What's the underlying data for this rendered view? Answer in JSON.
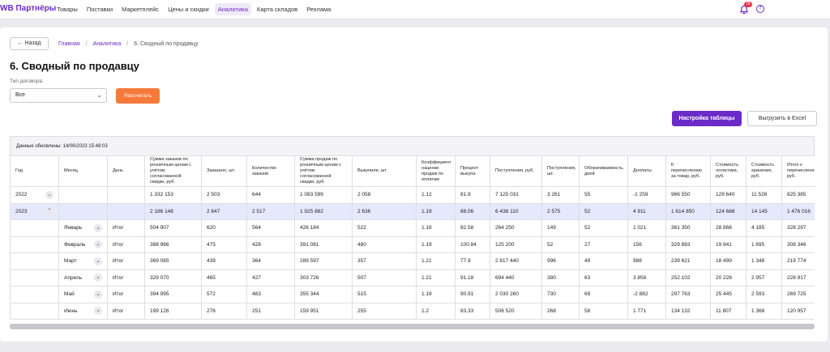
{
  "brand": "WB Партнёры",
  "nav": [
    "Товары",
    "Поставки",
    "Маркетплейс",
    "Цены и скидки",
    "Аналитика",
    "Карта складов",
    "Реклама"
  ],
  "nav_active_index": 4,
  "notification_count": "76",
  "breadcrumb": {
    "back": "← Назад",
    "items": [
      "Главная",
      "Аналитика",
      "6. Сводный по продавцу"
    ]
  },
  "title": "6. Сводный по продавцу",
  "contract_label": "Тип договора",
  "contract_value": "Все",
  "recalc_label": "Рассчитать",
  "settings_label": "Настройка таблицы",
  "export_label": "Выгрузить в Excel",
  "updated": "Данные обновлены: 14/06/2023 15:48:03",
  "columns": [
    "Год",
    "Месяц",
    "День",
    "Сумма заказов по розничным ценам с учётом согласованной скидки, руб.",
    "Заказано, шт.",
    "Количество заказов",
    "Сумма продаж по розничным ценам с учётом согласованной скидки, руб.",
    "Выкупили, шт.",
    "Коэффициент наценки продаж по оплатам",
    "Процент выкупа",
    "Поступления, руб.",
    "Поступления, шт.",
    "Оборачиваемость, дней",
    "Доплаты",
    "К перечислению за товар, руб.",
    "Стоимость логистики, руб.",
    "Стоимость хранения, руб.",
    "Итого к перечислению, руб."
  ],
  "rows": [
    {
      "year": "2022",
      "month": "",
      "day": "",
      "expanded": false,
      "values": [
        "1 332 153",
        "2 503",
        "644",
        "1 083 599",
        "2 058",
        "1.12",
        "81.9",
        "7 125 031",
        "3 261",
        "55",
        "-1 259",
        "966 550",
        "129 640",
        "11 526",
        "825 385"
      ]
    },
    {
      "year": "2023",
      "month": "",
      "day": "",
      "expanded": true,
      "values": [
        "2 186 148",
        "2 847",
        "2 517",
        "1 925 882",
        "2 636",
        "1.19",
        "88.06",
        "6 438 110",
        "2 575",
        "52",
        "4 911",
        "1 614 850",
        "124 688",
        "14 145",
        "1 476 016"
      ]
    },
    {
      "year": "",
      "month": "Январь",
      "day": "Итог",
      "values": [
        "504 907",
        "620",
        "564",
        "426 184",
        "522",
        "1.18",
        "82.58",
        "264 250",
        "149",
        "52",
        "1 021",
        "361 350",
        "28 868",
        "4 185",
        "328 297"
      ]
    },
    {
      "year": "",
      "month": "Февраль",
      "day": "Итог",
      "values": [
        "388 966",
        "475",
        "428",
        "391 081",
        "480",
        "1.19",
        "100.84",
        "125 200",
        "52",
        "27",
        "156",
        "329 883",
        "19 841",
        "1 695",
        "308 346"
      ]
    },
    {
      "year": "",
      "month": "Март",
      "day": "Итог",
      "values": [
        "369 085",
        "439",
        "364",
        "289 597",
        "357",
        "1.21",
        "77.9",
        "2 817 440",
        "996",
        "49",
        "988",
        "239 621",
        "18 499",
        "1 348",
        "219 774"
      ]
    },
    {
      "year": "",
      "month": "Апрель",
      "day": "Итог",
      "values": [
        "329 070",
        "465",
        "427",
        "303 726",
        "507",
        "1.21",
        "91.18",
        "694 440",
        "380",
        "63",
        "3 856",
        "252 102",
        "20 228",
        "2 957",
        "228 917"
      ]
    },
    {
      "year": "",
      "month": "Май",
      "day": "Итог",
      "values": [
        "394 995",
        "572",
        "483",
        "355 344",
        "515",
        "1.19",
        "90.91",
        "2 030 260",
        "730",
        "69",
        "-2 882",
        "297 763",
        "25 445",
        "2 593",
        "269 725"
      ]
    },
    {
      "year": "",
      "month": "Июнь",
      "day": "Итог",
      "values": [
        "199 126",
        "276",
        "251",
        "159 951",
        "255",
        "1.2",
        "83.33",
        "506 520",
        "268",
        "58",
        "1 771",
        "134 132",
        "11 807",
        "1 368",
        "120 957"
      ]
    }
  ],
  "icons": {
    "notifications": "bell-icon",
    "help": "help-icon",
    "dropdown": "chevron-down-icon",
    "expand": "chevron-up-icon"
  }
}
